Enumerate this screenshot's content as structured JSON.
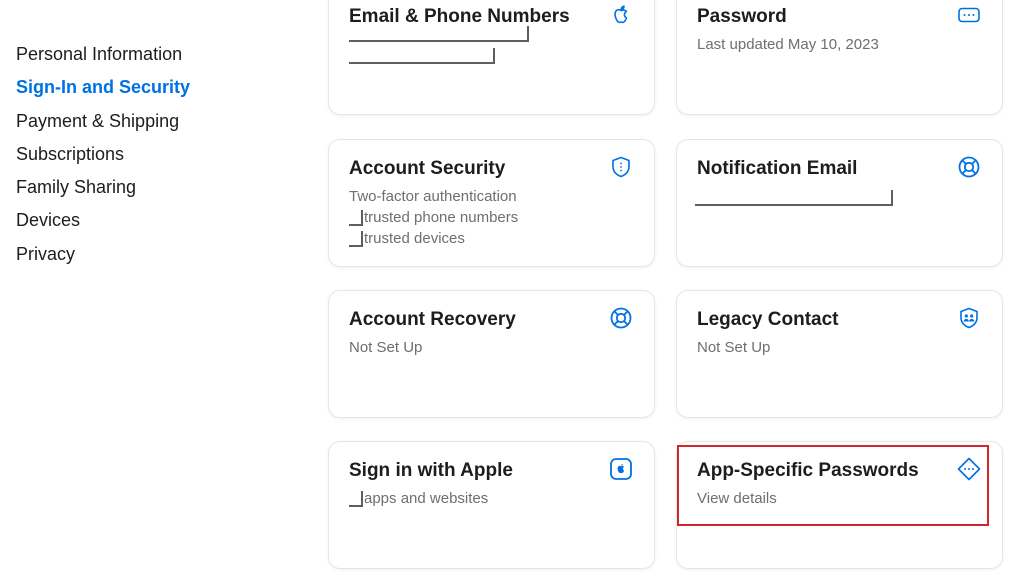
{
  "sidebar": {
    "items": [
      {
        "label": "Personal Information"
      },
      {
        "label": "Sign-In and Security"
      },
      {
        "label": "Payment & Shipping"
      },
      {
        "label": "Subscriptions"
      },
      {
        "label": "Family Sharing"
      },
      {
        "label": "Devices"
      },
      {
        "label": "Privacy"
      }
    ],
    "active_index": 1
  },
  "cards": {
    "email": {
      "title": "Email & Phone Numbers",
      "icon": "apple-logo-icon"
    },
    "password": {
      "title": "Password",
      "subtitle": "Last updated May 10, 2023",
      "icon": "password-dots-icon"
    },
    "account_security": {
      "title": "Account Security",
      "lines": [
        "Two-factor authentication",
        "trusted phone numbers",
        "trusted devices"
      ],
      "icon": "shield-icon"
    },
    "notification_email": {
      "title": "Notification Email",
      "icon": "lifebuoy-icon"
    },
    "account_recovery": {
      "title": "Account Recovery",
      "subtitle": "Not Set Up",
      "icon": "lifebuoy-icon"
    },
    "legacy_contact": {
      "title": "Legacy Contact",
      "subtitle": "Not Set Up",
      "icon": "people-shield-icon"
    },
    "sign_in_with_apple": {
      "title": "Sign in with Apple",
      "subtitle": "apps and websites",
      "icon": "apple-square-icon"
    },
    "app_specific_passwords": {
      "title": "App-Specific Passwords",
      "subtitle": "View details",
      "icon": "diamond-dots-icon"
    }
  },
  "colors": {
    "accent": "#0071e3",
    "highlight": "#d0282a",
    "text": "#1d1d1f",
    "secondary_text": "#6e6e73"
  }
}
